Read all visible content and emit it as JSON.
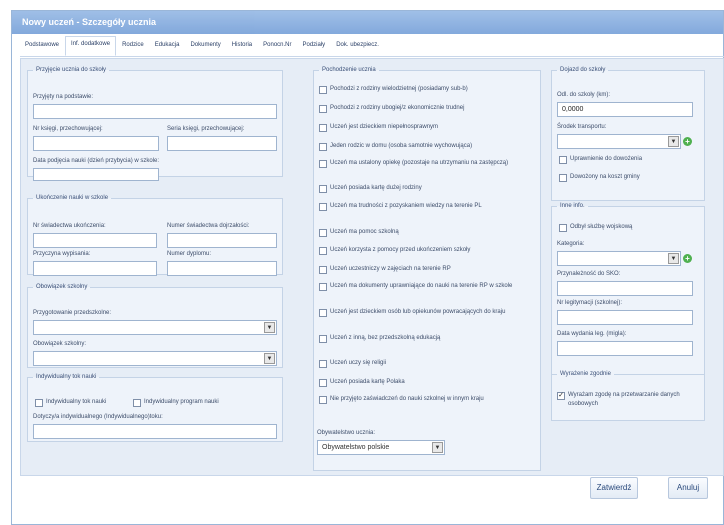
{
  "window": {
    "title": "Nowy uczeń - Szczegóły ucznia"
  },
  "tabs": [
    "Podstawowe",
    "Inf. dodatkowe",
    "Rodzice",
    "Edukacja",
    "Dokumenty",
    "Historia",
    "Ponocn.Nr",
    "Podziały",
    "Dok. ubezpiecz."
  ],
  "przyjecie": {
    "legend": "Przyjęcie ucznia do szkoły",
    "przyjety_label": "Przyjęty na podstawie:",
    "nr_ksiegi_label": "Nr księgi, przechowującej:",
    "seria_label": "Seria księgi, przechowującej:",
    "data_label": "Data podjęcia nauki (dzień przybycia) w szkole:"
  },
  "ukonczenie": {
    "legend": "Ukończenie nauki w szkole",
    "nr_swiad_label": "Nr świadectwa ukończenia:",
    "numer_swiad_label": "Numer świadectwa dojrzałości:",
    "przyczyna_label": "Przyczyna wypisania:",
    "numer_dyplomu_label": "Numer dyplomu:"
  },
  "obowiazek": {
    "legend": "Obowiązek szkolny",
    "przygotowanie_label": "Przygotowanie przedszkolne:",
    "obowiazek_label": "Obowiązek szkolny:"
  },
  "indywidualny": {
    "legend": "Indywidualny tok nauki",
    "cb1": "Indywidualny tok nauki",
    "cb2": "Indywidualny program nauki",
    "dotyczy_label": "Dotyczy/a indywidualnego (Indywidualnego)toku:"
  },
  "pochodzenie": {
    "legend": "Pochodzenie ucznia",
    "items": [
      "Pochodzi z rodziny wielodzietnej (posiadamy sub-b)",
      "Pochodzi z rodziny ubogiej/z ekonomicznie trudnej",
      "Uczeń jest dzieckiem niepełnosprawnym",
      "Jeden rodzic w domu (osoba samotnie wychowująca)",
      "Uczeń ma ustalony opiekę (pozostaje na utrzymaniu na zastępczą)",
      "Uczeń posiada kartę dużej rodziny",
      "Uczeń ma trudności z pozyskaniem wiedzy na terenie PL",
      "Uczeń ma pomoc szkolną",
      "Uczeń korzysta z pomocy przed ukończeniem szkoły",
      "Uczeń uczestniczy w zajęciach na terenie RP",
      "Uczeń ma dokumenty uprawniające do nauki na terenie RP w szkole",
      "Uczeń jest dzieckiem osób lub opiekunów powracających do kraju",
      "Uczeń z inną, bez przedszkolną edukacją",
      "Uczeń uczy się religii",
      "Uczeń posiada kartę Polaka",
      "Nie przyjęto zaświadczeń do nauki szkolnej w innym kraju"
    ],
    "obywatelstwo_label": "Obywatelstwo ucznia:",
    "obywatelstwo_value": "Obywatelstwo polskie"
  },
  "dojazd": {
    "legend": "Dojazd do szkoły",
    "odl_label": "Odl. do szkoły (km):",
    "odl_value": "0,0000",
    "srodek_label": "Środek transportu:",
    "cb1": "Uprawnienie do dowożenia",
    "cb2": "Dowożony na koszt gminy"
  },
  "inne": {
    "legend": "Inne info.",
    "cb1": "Odbył służbę wojskową",
    "kategoria_label": "Kategoria:",
    "przynaleznosc_label": "Przynależność do SKO:",
    "nr_legitymacji_label": "Nr legitymacji (szkolnej):",
    "data_label": "Data wydania leg. (migla):"
  },
  "zgoda": {
    "legend": "Wyrażenie zgodnie",
    "cb1": "Wyrażam zgodę na przetwarzanie danych osobowych"
  },
  "buttons": {
    "ok": "Zatwierdź",
    "cancel": "Anuluj"
  }
}
